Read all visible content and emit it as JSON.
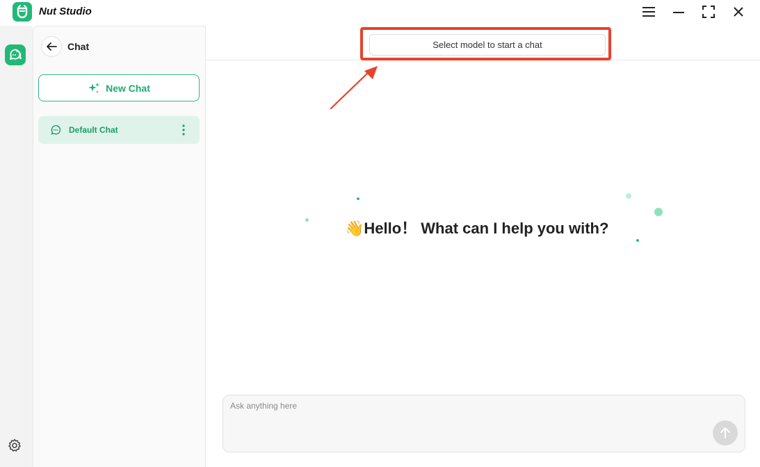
{
  "app": {
    "title": "Nut Studio"
  },
  "window": {
    "menu_icon": "hamburger-icon",
    "minimize_icon": "minimize-icon",
    "maximize_icon": "maximize-icon",
    "close_icon": "close-icon"
  },
  "rail": {
    "chat_icon": "chat-bubbles-icon",
    "settings_icon": "gear-icon"
  },
  "sidebar": {
    "title": "Chat",
    "new_chat_label": "New Chat",
    "chats": [
      {
        "label": "Default Chat"
      }
    ]
  },
  "main": {
    "model_select_label": "Select model to start a chat",
    "greeting": "👋Hello！ What can I help you with?",
    "input_placeholder": "Ask anything here"
  },
  "colors": {
    "accent": "#22b87a",
    "highlight": "#e5432b",
    "active_item_bg": "#dff3ea"
  }
}
